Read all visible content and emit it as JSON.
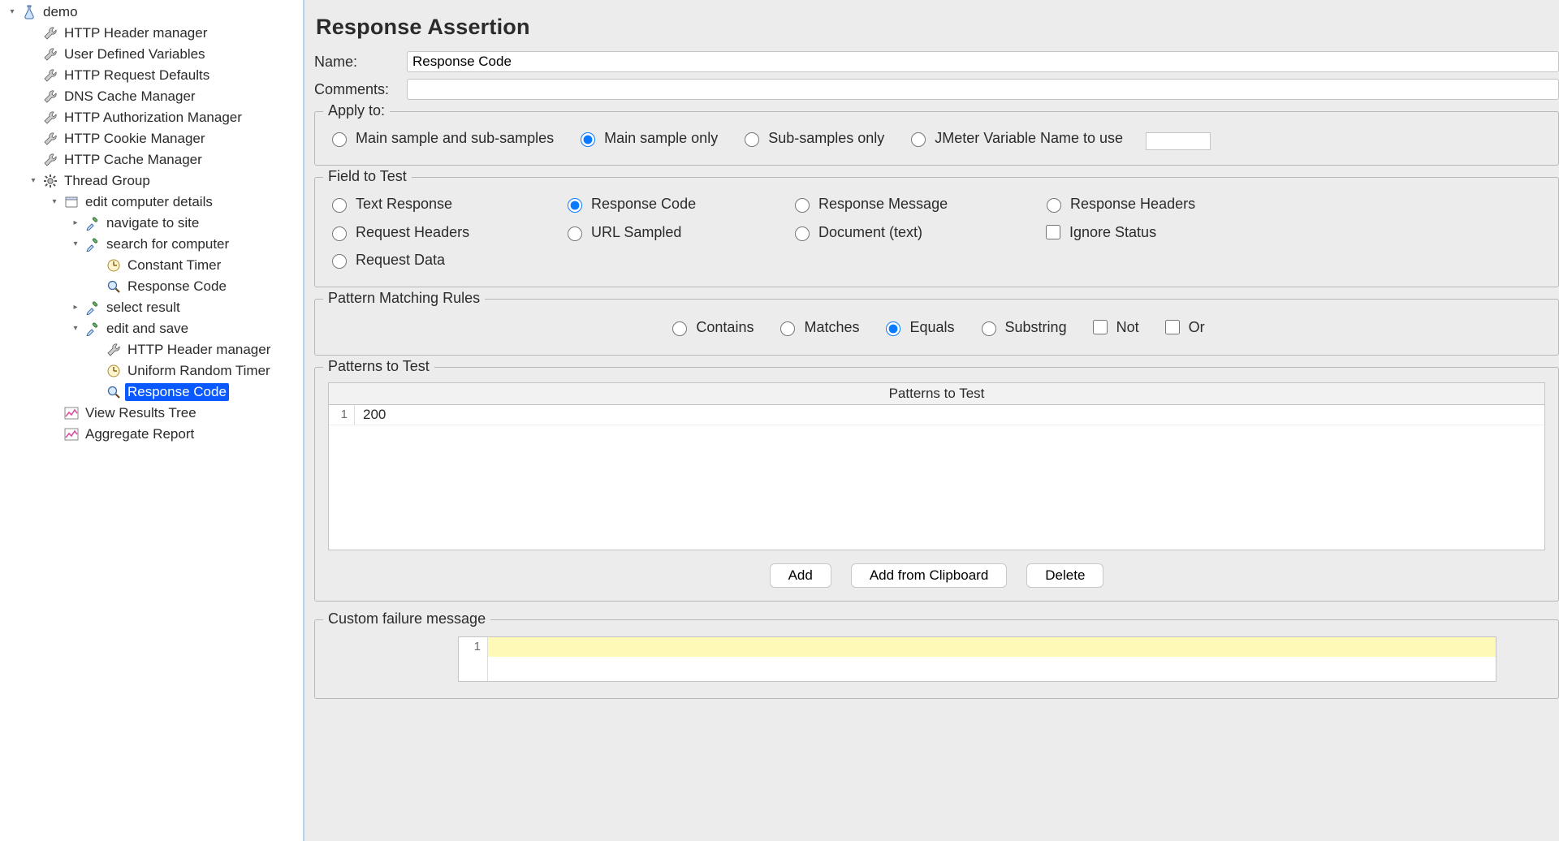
{
  "tree": [
    {
      "indent": 0,
      "toggle": "down",
      "icon": "flask",
      "label": "demo"
    },
    {
      "indent": 1,
      "toggle": "",
      "icon": "wrench",
      "label": "HTTP Header manager"
    },
    {
      "indent": 1,
      "toggle": "",
      "icon": "wrench",
      "label": "User Defined Variables"
    },
    {
      "indent": 1,
      "toggle": "",
      "icon": "wrench",
      "label": "HTTP Request Defaults"
    },
    {
      "indent": 1,
      "toggle": "",
      "icon": "wrench",
      "label": "DNS Cache Manager"
    },
    {
      "indent": 1,
      "toggle": "",
      "icon": "wrench",
      "label": "HTTP Authorization Manager"
    },
    {
      "indent": 1,
      "toggle": "",
      "icon": "wrench",
      "label": "HTTP Cookie Manager"
    },
    {
      "indent": 1,
      "toggle": "",
      "icon": "wrench",
      "label": "HTTP Cache Manager"
    },
    {
      "indent": 1,
      "toggle": "down",
      "icon": "gear",
      "label": "Thread Group"
    },
    {
      "indent": 2,
      "toggle": "down",
      "icon": "box",
      "label": "edit computer details"
    },
    {
      "indent": 3,
      "toggle": "right",
      "icon": "dropper",
      "label": "navigate to site"
    },
    {
      "indent": 3,
      "toggle": "down",
      "icon": "dropper",
      "label": "search for computer"
    },
    {
      "indent": 4,
      "toggle": "",
      "icon": "clock",
      "label": "Constant Timer"
    },
    {
      "indent": 4,
      "toggle": "",
      "icon": "lens",
      "label": "Response Code"
    },
    {
      "indent": 3,
      "toggle": "right",
      "icon": "dropper",
      "label": "select result"
    },
    {
      "indent": 3,
      "toggle": "down",
      "icon": "dropper",
      "label": "edit and save"
    },
    {
      "indent": 4,
      "toggle": "",
      "icon": "wrench",
      "label": "HTTP Header manager"
    },
    {
      "indent": 4,
      "toggle": "",
      "icon": "clock",
      "label": "Uniform Random Timer"
    },
    {
      "indent": 4,
      "toggle": "",
      "icon": "lens",
      "label": "Response Code",
      "selected": true
    },
    {
      "indent": 2,
      "toggle": "",
      "icon": "chart",
      "label": "View Results Tree"
    },
    {
      "indent": 2,
      "toggle": "",
      "icon": "chart",
      "label": "Aggregate Report"
    }
  ],
  "panel": {
    "title": "Response Assertion",
    "name_label": "Name:",
    "name_value": "Response Code",
    "comments_label": "Comments:",
    "comments_value": ""
  },
  "apply_to": {
    "legend": "Apply to:",
    "options": [
      {
        "label": "Main sample and sub-samples",
        "checked": false
      },
      {
        "label": "Main sample only",
        "checked": true
      },
      {
        "label": "Sub-samples only",
        "checked": false
      },
      {
        "label": "JMeter Variable Name to use",
        "checked": false,
        "has_input": true
      }
    ]
  },
  "field_to_test": {
    "legend": "Field to Test",
    "options": [
      {
        "label": "Text Response",
        "checked": false
      },
      {
        "label": "Response Code",
        "checked": true
      },
      {
        "label": "Response Message",
        "checked": false
      },
      {
        "label": "Response Headers",
        "checked": false
      },
      {
        "label": "Request Headers",
        "checked": false
      },
      {
        "label": "URL Sampled",
        "checked": false
      },
      {
        "label": "Document (text)",
        "checked": false
      },
      {
        "label": "Ignore Status",
        "type": "checkbox",
        "checked": false
      },
      {
        "label": "Request Data",
        "checked": false
      }
    ]
  },
  "pattern_matching": {
    "legend": "Pattern Matching Rules",
    "radios": [
      {
        "label": "Contains",
        "checked": false
      },
      {
        "label": "Matches",
        "checked": false
      },
      {
        "label": "Equals",
        "checked": true
      },
      {
        "label": "Substring",
        "checked": false
      }
    ],
    "checks": [
      {
        "label": "Not",
        "checked": false
      },
      {
        "label": "Or",
        "checked": false
      }
    ]
  },
  "patterns": {
    "legend": "Patterns to Test",
    "header": "Patterns to Test",
    "rows": [
      {
        "n": "1",
        "value": "200"
      }
    ],
    "buttons": {
      "add": "Add",
      "clipboard": "Add from Clipboard",
      "delete": "Delete"
    }
  },
  "failure": {
    "legend": "Custom failure message",
    "gutter": "1"
  }
}
